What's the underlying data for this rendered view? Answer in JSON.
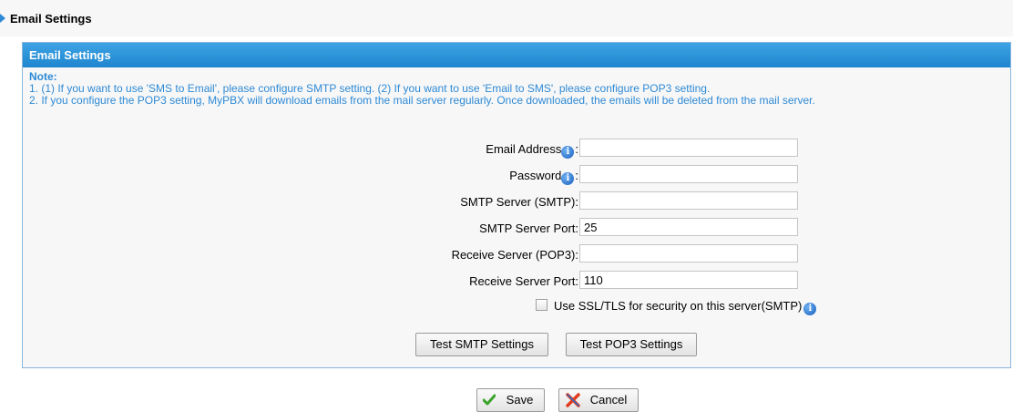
{
  "page": {
    "title": "Email Settings"
  },
  "panel": {
    "header": "Email Settings",
    "note_title": "Note:",
    "note_lines": [
      "1. (1) If you want to use 'SMS to Email', please configure SMTP setting. (2) If you want to use 'Email to SMS', please configure POP3 setting.",
      "2. If you configure the POP3 setting, MyPBX will download emails from the mail server regularly. Once downloaded, the emails will be deleted from the mail server."
    ]
  },
  "form": {
    "email_address": {
      "label": "Email Address",
      "value": ""
    },
    "password": {
      "label": "Password",
      "value": ""
    },
    "smtp_server": {
      "label": "SMTP Server (SMTP):",
      "value": ""
    },
    "smtp_port": {
      "label": "SMTP Server Port:",
      "value": "25"
    },
    "pop3_server": {
      "label": "Receive Server (POP3):",
      "value": ""
    },
    "pop3_port": {
      "label": "Receive Server Port:",
      "value": "110"
    },
    "ssl_label": "Use SSL/TLS for security on this server(SMTP)",
    "ssl_checked": false
  },
  "buttons": {
    "test_smtp": "Test SMTP Settings",
    "test_pop3": "Test POP3 Settings",
    "save": "Save",
    "cancel": "Cancel"
  },
  "colors": {
    "accent": "#2e8ad6",
    "header_gradient_top": "#3fa4e4",
    "header_gradient_bottom": "#1e85cf",
    "cancel_icon": "#e23b1e",
    "save_icon": "#3aa32a"
  },
  "icons": {
    "info": "info-icon",
    "section_arrow": "arrow-right-icon",
    "save": "check-icon",
    "cancel": "x-icon"
  }
}
